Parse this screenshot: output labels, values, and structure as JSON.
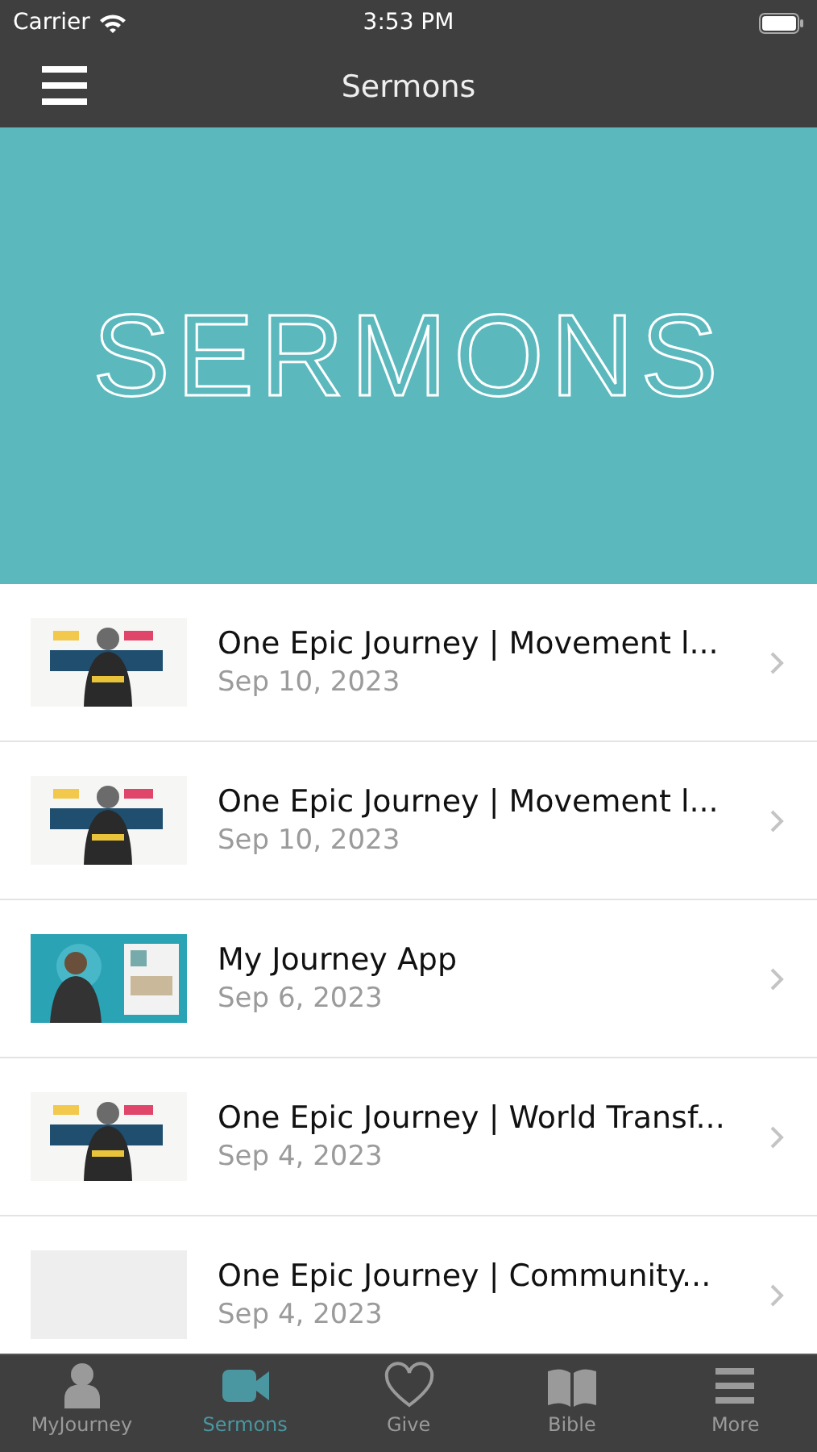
{
  "status_bar": {
    "carrier": "Carrier",
    "time": "3:53 PM"
  },
  "nav": {
    "title": "Sermons"
  },
  "banner": {
    "title": "SERMONS"
  },
  "sermons": [
    {
      "title": "One Epic Journey | Movement l...",
      "date": "Sep 10, 2023",
      "kind": "picture"
    },
    {
      "title": "One Epic Journey | Movement l...",
      "date": "Sep 10, 2023",
      "kind": "picture"
    },
    {
      "title": "My Journey App",
      "date": "Sep 6, 2023",
      "kind": "picture"
    },
    {
      "title": "One Epic Journey | World Transf...",
      "date": "Sep 4, 2023",
      "kind": "picture"
    },
    {
      "title": "One Epic Journey | Community...",
      "date": "Sep 4, 2023",
      "kind": "placeholder"
    }
  ],
  "tabs": [
    {
      "label": "MyJourney",
      "selected": false
    },
    {
      "label": "Sermons",
      "selected": true
    },
    {
      "label": "Give",
      "selected": false
    },
    {
      "label": "Bible",
      "selected": false
    },
    {
      "label": "More",
      "selected": false
    }
  ]
}
